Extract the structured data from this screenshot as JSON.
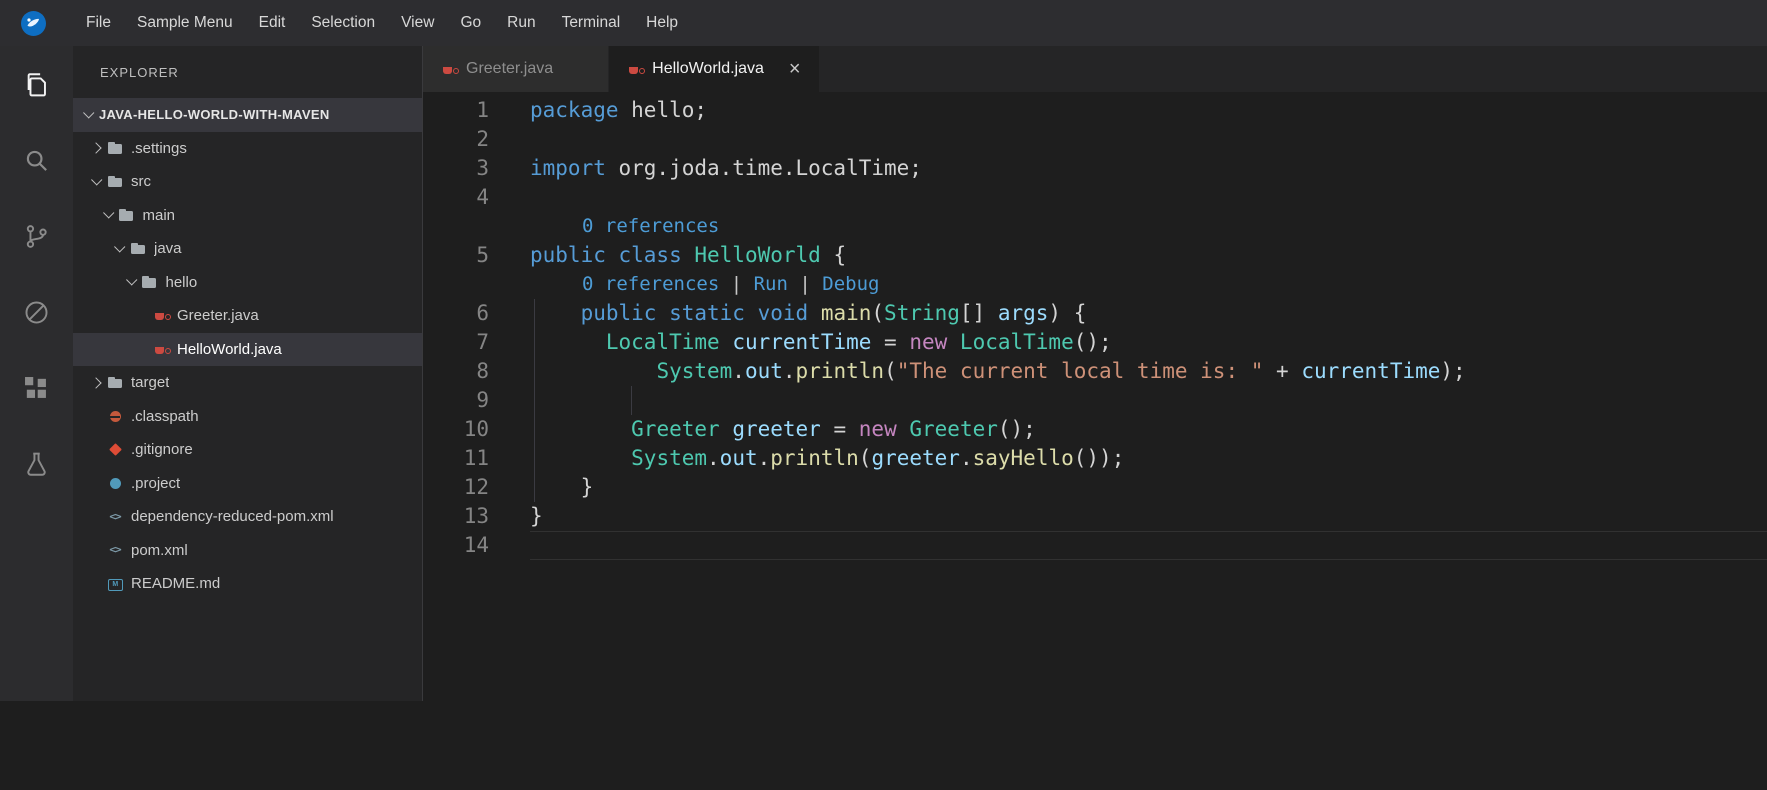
{
  "menu": {
    "logo_icon": "app-logo-icon",
    "items": [
      "File",
      "Sample Menu",
      "Edit",
      "Selection",
      "View",
      "Go",
      "Run",
      "Terminal",
      "Help"
    ]
  },
  "activity_bar": {
    "items": [
      {
        "name": "explorer",
        "icon": "files-icon",
        "active": true
      },
      {
        "name": "search",
        "icon": "search-icon",
        "active": false
      },
      {
        "name": "source-control",
        "icon": "source-control-icon",
        "active": false
      },
      {
        "name": "debug-disabled",
        "icon": "debug-disabled-icon",
        "active": false
      },
      {
        "name": "extensions",
        "icon": "extensions-icon",
        "active": false
      },
      {
        "name": "testing",
        "icon": "beaker-icon",
        "active": false
      }
    ]
  },
  "sidebar": {
    "title": "EXPLORER",
    "root": "JAVA-HELLO-WORLD-WITH-MAVEN",
    "tree": [
      {
        "label": ".settings",
        "kind": "folder",
        "state": "collapsed",
        "icon": "folder-icon",
        "indent": 1
      },
      {
        "label": "src",
        "kind": "folder",
        "state": "expanded",
        "icon": "folder-icon",
        "indent": 1
      },
      {
        "label": "main",
        "kind": "folder",
        "state": "expanded",
        "icon": "folder-icon",
        "indent": 2
      },
      {
        "label": "java",
        "kind": "folder",
        "state": "expanded",
        "icon": "folder-icon",
        "indent": 3
      },
      {
        "label": "hello",
        "kind": "folder",
        "state": "expanded",
        "icon": "folder-icon",
        "indent": 4
      },
      {
        "label": "Greeter.java",
        "kind": "file",
        "icon": "java-file-icon",
        "indent": 5
      },
      {
        "label": "HelloWorld.java",
        "kind": "file",
        "icon": "java-file-icon",
        "indent": 5,
        "selected": true
      },
      {
        "label": "target",
        "kind": "folder",
        "state": "collapsed",
        "icon": "folder-icon",
        "indent": 1
      },
      {
        "label": ".classpath",
        "kind": "file",
        "icon": "classpath-file-icon",
        "indent": 1
      },
      {
        "label": ".gitignore",
        "kind": "file",
        "icon": "git-file-icon",
        "indent": 1
      },
      {
        "label": ".project",
        "kind": "file",
        "icon": "project-file-icon",
        "indent": 1
      },
      {
        "label": "dependency-reduced-pom.xml",
        "kind": "file",
        "icon": "xml-file-icon",
        "indent": 1
      },
      {
        "label": "pom.xml",
        "kind": "file",
        "icon": "xml-file-icon",
        "indent": 1
      },
      {
        "label": "README.md",
        "kind": "file",
        "icon": "markdown-file-icon",
        "indent": 1
      }
    ]
  },
  "tabs": [
    {
      "label": "Greeter.java",
      "icon": "java-file-icon",
      "active": false
    },
    {
      "label": "HelloWorld.java",
      "icon": "java-file-icon",
      "active": true,
      "close_label": "×"
    }
  ],
  "editor": {
    "lines": [
      {
        "n": "1",
        "toks": [
          [
            "kw",
            "package"
          ],
          [
            "fg",
            " hello;"
          ]
        ]
      },
      {
        "n": "2",
        "toks": []
      },
      {
        "n": "3",
        "toks": [
          [
            "kw",
            "import"
          ],
          [
            "fg",
            " org.joda.time.LocalTime;"
          ]
        ]
      },
      {
        "n": "4",
        "toks": []
      },
      {
        "lens": true,
        "indent": 52,
        "toks": [
          [
            "lens",
            "0 references"
          ]
        ]
      },
      {
        "n": "5",
        "toks": [
          [
            "kw",
            "public class"
          ],
          [
            "fg",
            " "
          ],
          [
            "type",
            "HelloWorld"
          ],
          [
            "fg",
            " {"
          ]
        ]
      },
      {
        "lens": true,
        "indent": 52,
        "toks": [
          [
            "lens",
            "0 references"
          ],
          [
            "lenssep",
            " | "
          ],
          [
            "lenslink",
            "Run"
          ],
          [
            "lenssep",
            " | "
          ],
          [
            "lenslink",
            "Debug"
          ]
        ]
      },
      {
        "n": "6",
        "guides": [
          4
        ],
        "toks": [
          [
            "fg",
            "    "
          ],
          [
            "kw",
            "public static void"
          ],
          [
            "fg",
            " "
          ],
          [
            "fn",
            "main"
          ],
          [
            "fg",
            "("
          ],
          [
            "type",
            "String"
          ],
          [
            "fg",
            "[] "
          ],
          [
            "var",
            "args"
          ],
          [
            "fg",
            ") {"
          ]
        ]
      },
      {
        "n": "7",
        "guides": [
          4
        ],
        "toks": [
          [
            "fg",
            "      "
          ],
          [
            "type",
            "LocalTime"
          ],
          [
            "fg",
            " "
          ],
          [
            "var",
            "currentTime"
          ],
          [
            "fg",
            " = "
          ],
          [
            "kwc",
            "new"
          ],
          [
            "fg",
            " "
          ],
          [
            "type",
            "LocalTime"
          ],
          [
            "fg",
            "();"
          ]
        ]
      },
      {
        "n": "8",
        "guides": [
          4
        ],
        "toks": [
          [
            "fg",
            "          "
          ],
          [
            "type",
            "System"
          ],
          [
            "fg",
            "."
          ],
          [
            "var",
            "out"
          ],
          [
            "fg",
            "."
          ],
          [
            "fn",
            "println"
          ],
          [
            "fg",
            "("
          ],
          [
            "str",
            "\"The current local time is: \""
          ],
          [
            "fg",
            " + "
          ],
          [
            "var",
            "currentTime"
          ],
          [
            "fg",
            ");"
          ]
        ]
      },
      {
        "n": "9",
        "guides": [
          4,
          101
        ],
        "toks": []
      },
      {
        "n": "10",
        "guides": [
          4
        ],
        "toks": [
          [
            "fg",
            "        "
          ],
          [
            "type",
            "Greeter"
          ],
          [
            "fg",
            " "
          ],
          [
            "var",
            "greeter"
          ],
          [
            "fg",
            " = "
          ],
          [
            "kwc",
            "new"
          ],
          [
            "fg",
            " "
          ],
          [
            "type",
            "Greeter"
          ],
          [
            "fg",
            "();"
          ]
        ]
      },
      {
        "n": "11",
        "guides": [
          4
        ],
        "toks": [
          [
            "fg",
            "        "
          ],
          [
            "type",
            "System"
          ],
          [
            "fg",
            "."
          ],
          [
            "var",
            "out"
          ],
          [
            "fg",
            "."
          ],
          [
            "fn",
            "println"
          ],
          [
            "fg",
            "("
          ],
          [
            "var",
            "greeter"
          ],
          [
            "fg",
            "."
          ],
          [
            "fn",
            "sayHello"
          ],
          [
            "fg",
            "());"
          ]
        ]
      },
      {
        "n": "12",
        "guides": [
          4
        ],
        "toks": [
          [
            "fg",
            "    }"
          ]
        ]
      },
      {
        "n": "13",
        "toks": [
          [
            "fg",
            "}"
          ]
        ]
      },
      {
        "n": "14",
        "current": true,
        "toks": []
      }
    ]
  },
  "colors": {
    "keyword": "#569cd6",
    "keyword_new": "#c586c0",
    "type_name": "#4ec9b0",
    "function_name": "#dcdcaa",
    "variable": "#9cdcfe",
    "string": "#ce9178",
    "codelens": "#4d9cd6",
    "editor_bg": "#1e1e1e",
    "sidebar_bg": "#252526",
    "selection_bg": "#37373d",
    "java_icon": "#cc4a41"
  }
}
